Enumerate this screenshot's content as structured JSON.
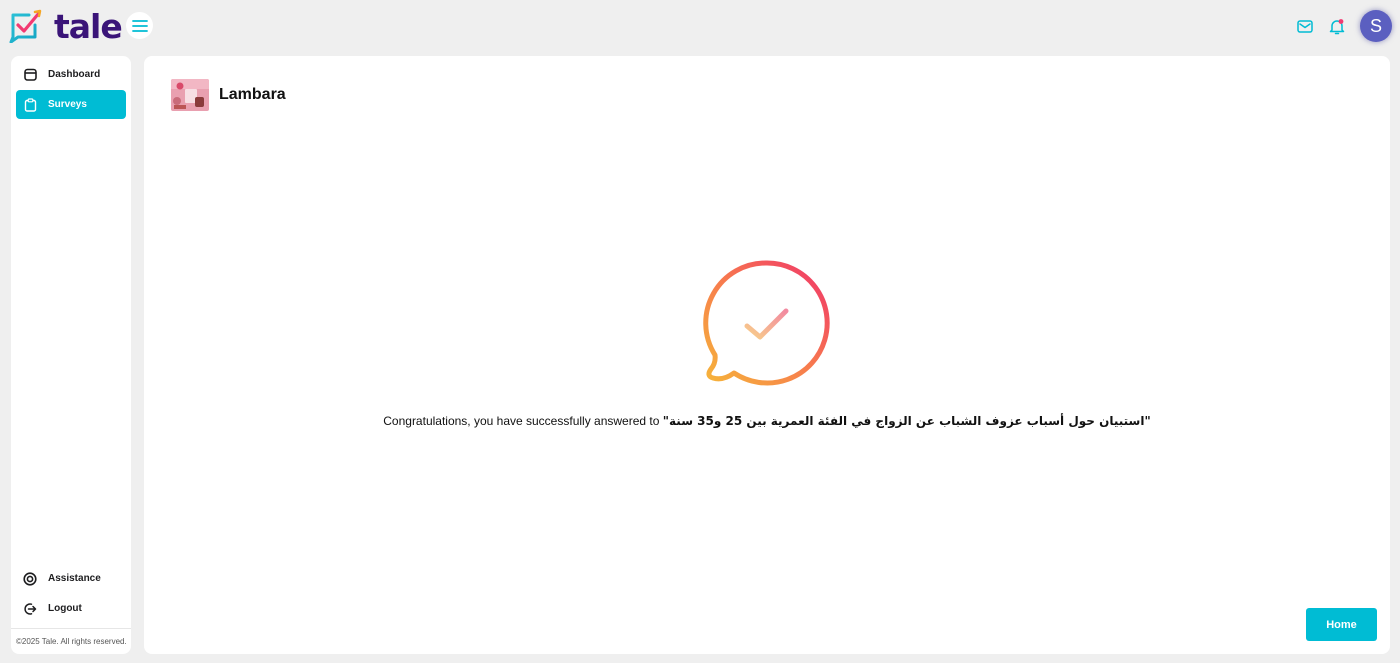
{
  "app": {
    "logo_text": "tale",
    "brand_color": "#3a1478",
    "accent_color": "#00bcd4"
  },
  "header": {
    "menu_icon": "hamburger-menu-icon",
    "mail_icon": "mail-icon",
    "notification_icon": "bell-icon",
    "avatar_initial": "S"
  },
  "sidebar": {
    "items": [
      {
        "label": "Dashboard",
        "icon": "calendar-icon",
        "active": false
      },
      {
        "label": "Surveys",
        "icon": "clipboard-icon",
        "active": true
      },
      {
        "label": "Assistance",
        "icon": "lifebuoy-icon",
        "active": false
      },
      {
        "label": "Logout",
        "icon": "logout-icon",
        "active": false
      }
    ],
    "copyright": "©2025 Tale. All rights reserved."
  },
  "main": {
    "brand_name": "Lambara",
    "success_icon": "chat-bubble-checkmark-icon",
    "message_prefix": "Congratulations, you have successfully answered to ",
    "survey_title": "\"استبيان حول أسباب عزوف الشباب عن الزواج في الفئة العمرية بين 25 و35 سنة\"",
    "home_button": "Home"
  }
}
